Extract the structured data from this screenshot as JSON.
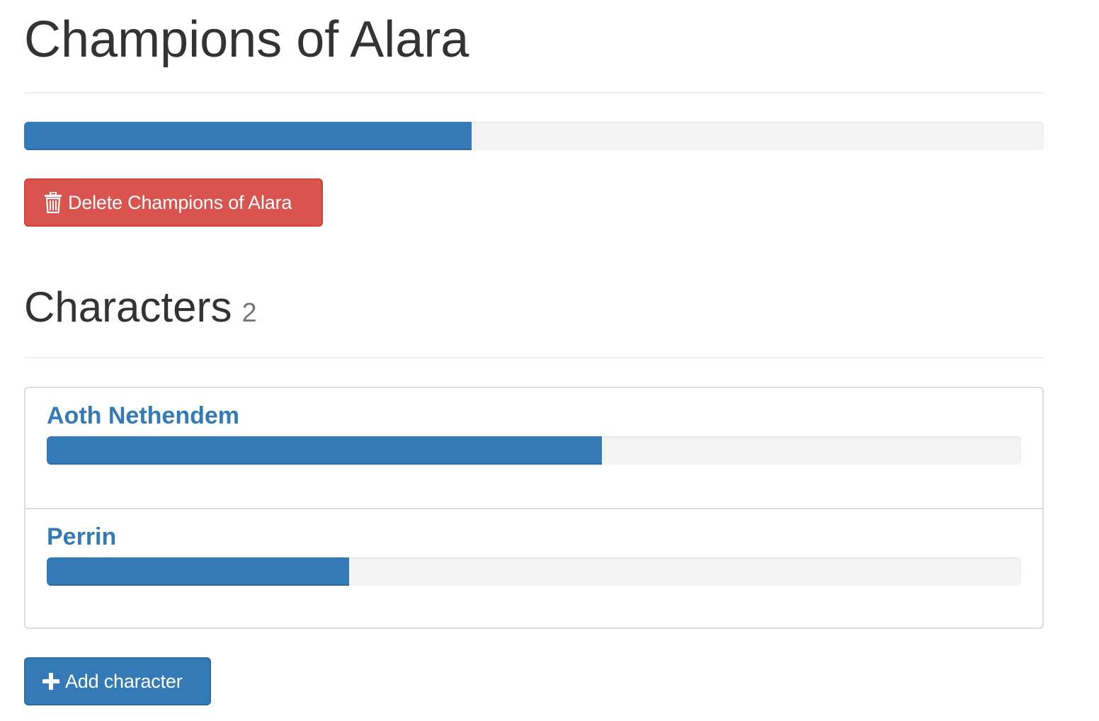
{
  "page": {
    "title": "Champions of Alara",
    "progress_fraction": 0.439
  },
  "actions": {
    "delete_label": "Delete Champions of Alara",
    "delete_icon": "trash-icon",
    "add_label": "Add character",
    "add_icon": "plus-icon"
  },
  "characters": {
    "heading": "Characters",
    "count": "2",
    "items": [
      {
        "name": "Aoth Nethendem",
        "progress_fraction": 0.57
      },
      {
        "name": "Perrin",
        "progress_fraction": 0.31
      }
    ]
  },
  "colors": {
    "primary": "#337ab7",
    "danger": "#d9534f",
    "track": "#f3f3f3"
  }
}
